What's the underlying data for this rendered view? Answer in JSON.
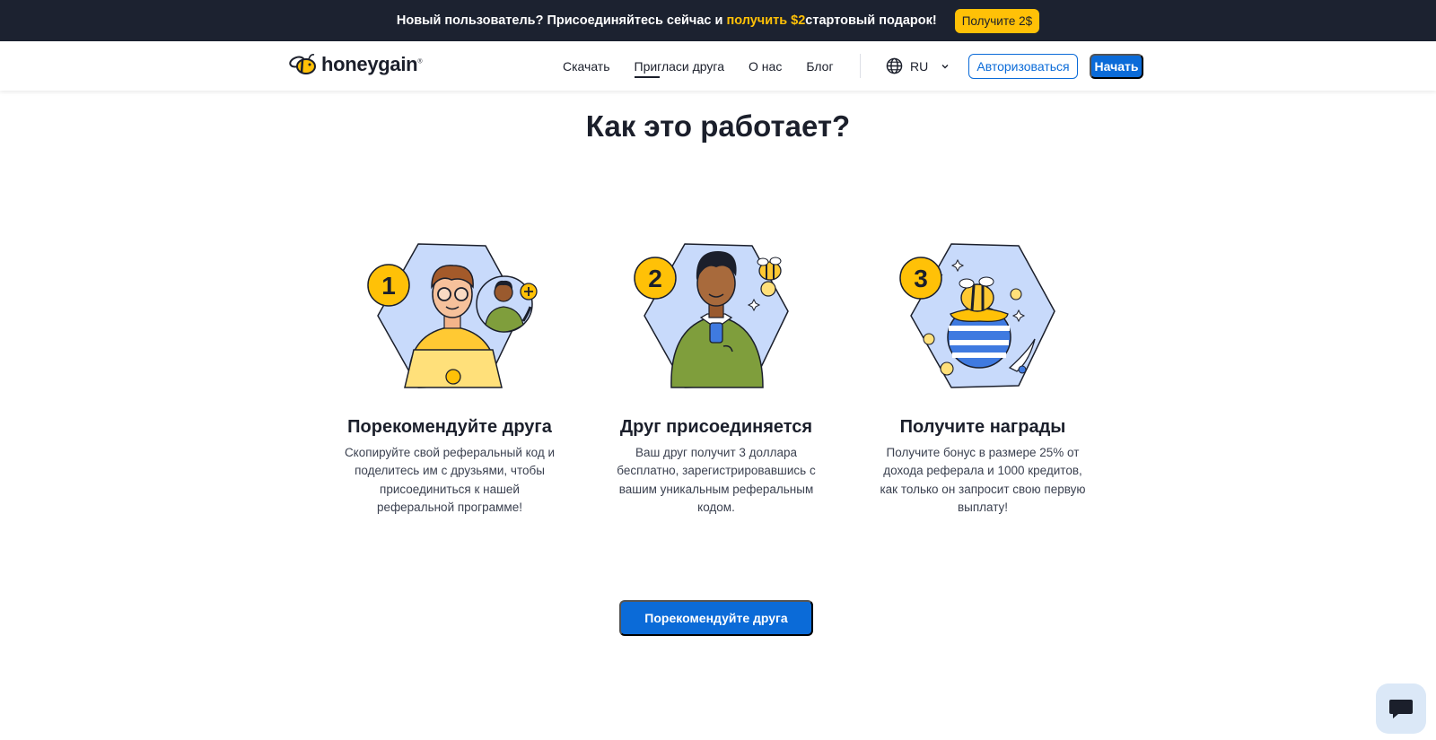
{
  "promo": {
    "text_before": "Новый пользователь? Присоединяйтесь сейчас и ",
    "text_highlight": "получить $2",
    "text_after": "стартовый подарок!",
    "button_label": "Получите 2$",
    "highlight_color": "#ffc107"
  },
  "nav": {
    "logo_text": "honeygain",
    "logo_mark": "®",
    "links": [
      "Скачать",
      "Пригласи друга",
      "О нас",
      "Блог"
    ],
    "language": "RU",
    "login_label": "Авторизоваться",
    "start_label": "Начать",
    "accent_color": "#0b6bd8"
  },
  "main": {
    "title": "Как это работает?",
    "steps": [
      {
        "number": "1",
        "title": "Порекомендуйте друга",
        "desc": "Скопируйте свой реферальный код и поделитесь им с друзьями, чтобы присоединиться к нашей реферальной программе!",
        "icon": "person-with-laptop-icon"
      },
      {
        "number": "2",
        "title": "Друг присоединяется",
        "desc": "Ваш друг получит 3 доллара бесплатно, зарегистрировавшись с вашим уникальным реферальным кодом.",
        "icon": "person-with-phone-icon"
      },
      {
        "number": "3",
        "title": "Получите награды",
        "desc": "Получите бонус в размере 25% от дохода реферала и 1000 кредитов, как только он запросит свою первую выплату!",
        "icon": "bee-honey-pot-icon"
      }
    ],
    "cta_label": "Порекомендуйте друга"
  },
  "chat": {
    "icon": "chat-icon"
  }
}
